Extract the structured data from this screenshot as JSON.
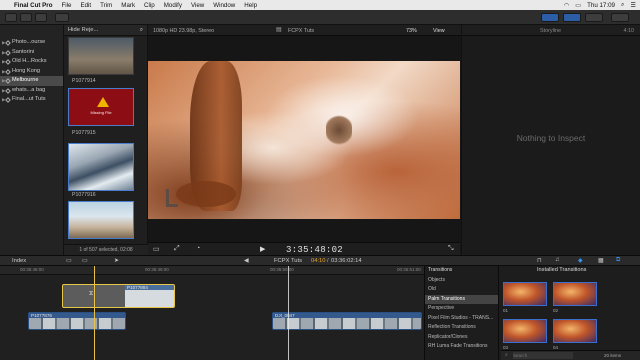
{
  "menubar": {
    "app_name": "Final Cut Pro",
    "menus": [
      "File",
      "Edit",
      "Trim",
      "Mark",
      "Clip",
      "Modify",
      "View",
      "Window",
      "Help"
    ],
    "clock": "Thu 17:09"
  },
  "libraries": {
    "items": [
      {
        "label": "Photo...ourse",
        "selected": false
      },
      {
        "label": "Santorini",
        "selected": false
      },
      {
        "label": "Old H...Rocks",
        "selected": false
      },
      {
        "label": "Hong Kong",
        "selected": false
      },
      {
        "label": "Melbourne",
        "selected": true
      },
      {
        "label": "whats...a bag",
        "selected": false
      },
      {
        "label": "Final...ut Tuts",
        "selected": false
      }
    ]
  },
  "browser": {
    "filter": "Hide Reje...",
    "clips": [
      "P1077914",
      "P1077915",
      "P1077916"
    ],
    "missing_file": "Missing File",
    "status": "1 of 507 selected, 02:08"
  },
  "viewer": {
    "format": "1080p HD 23.98p, Stereo",
    "project": "FCPX Tuts",
    "zoom": "73%",
    "view_menu": "View",
    "timecode": "3:35:48:02"
  },
  "inspector": {
    "title": "Storyline",
    "duration": "4:10",
    "empty_message": "Nothing to Inspect"
  },
  "timeline": {
    "index_label": "Index",
    "project": "FCPX Tuts",
    "position": "04:10",
    "total": "03:36:02:14",
    "ruler": [
      "00:35:48:00",
      "00:35:49:00",
      "00:35:50:00",
      "00:35:51:00",
      "00:35:52:00"
    ],
    "clips": [
      "P1077884",
      "P1077876",
      "DJI_0047"
    ]
  },
  "transitions": {
    "header": "Transitions",
    "installed": "Installed Transitions",
    "categories": [
      {
        "label": "Objects",
        "selected": false
      },
      {
        "label": "Old",
        "selected": false
      },
      {
        "label": "Palm Transitions",
        "selected": true
      },
      {
        "label": "Perspective",
        "selected": false
      },
      {
        "label": "Pixel Film Studios - TRANS...",
        "selected": false
      },
      {
        "label": "Reflection Transitions",
        "selected": false
      },
      {
        "label": "Replicator/Clones",
        "selected": false
      },
      {
        "label": "RH Luma Fade Transitions",
        "selected": false
      }
    ],
    "thumbs": [
      "01",
      "02",
      "03",
      "04"
    ],
    "search_placeholder": "Search",
    "count": "20 items"
  },
  "colors": {
    "accent_blue": "#2b5ea6",
    "timeline_playhead": "#e8c24a",
    "selection_yellow": "#e7c64a",
    "viewer_bg": "#161616"
  }
}
